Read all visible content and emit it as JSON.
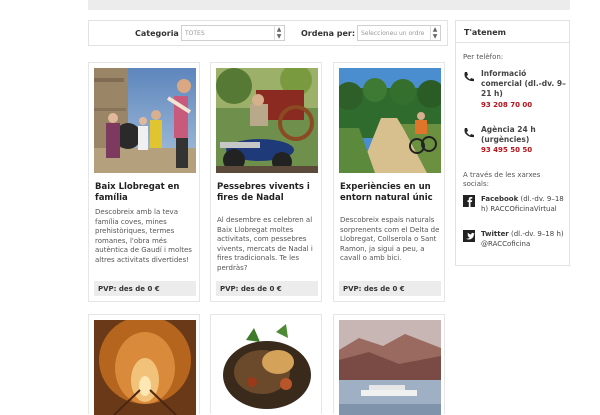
{
  "filters": {
    "category_label": "Categoria",
    "category_value": "TOTES",
    "order_label": "Ordena per:",
    "order_value": "Seleccioneu un ordre"
  },
  "cards": [
    {
      "title": "Baix Llobregat en família",
      "description": "Descobreix amb la teva família coves, mines prehistòriques, termes romanes, l'obra més autèntica de Gaudí i moltes altres activitats divertides!",
      "price": "PVP: des de 0 €"
    },
    {
      "title": "Pessebres vivents i fires de Nadal",
      "description": "Al desembre es celebren al Baix Llobregat moltes activitats, com pessebres vivents, mercats de Nadal i fires tradicionals. Te les perdràs?",
      "price": "PVP: des de 0 €"
    },
    {
      "title": "Experiències en un entorn natural únic",
      "description": "Descobreix espais naturals sorprenents com el Delta de Llobregat, Collserola o Sant Ramon, ja sigui a peu, a cavall o amb bici.",
      "price": "PVP: des de 0 €"
    }
  ],
  "sidebar": {
    "title": "T'atenem",
    "by_phone": "Per telèfon:",
    "info_title": "Informació comercial (dl.-dv. 9–21 h)",
    "info_phone": "93 208 70 00",
    "agency_title": "Agència 24 h (urgències)",
    "agency_phone": "93 495 50 50",
    "social_label": "A través de les xarxes socials:",
    "facebook_name": "Facebook",
    "facebook_hours": " (dl.-dv. 9–18 h) RACCOficinaVirtual",
    "twitter_name": "Twitter",
    "twitter_hours": " (dl.-dv. 9–18 h) @RACCoficina"
  }
}
